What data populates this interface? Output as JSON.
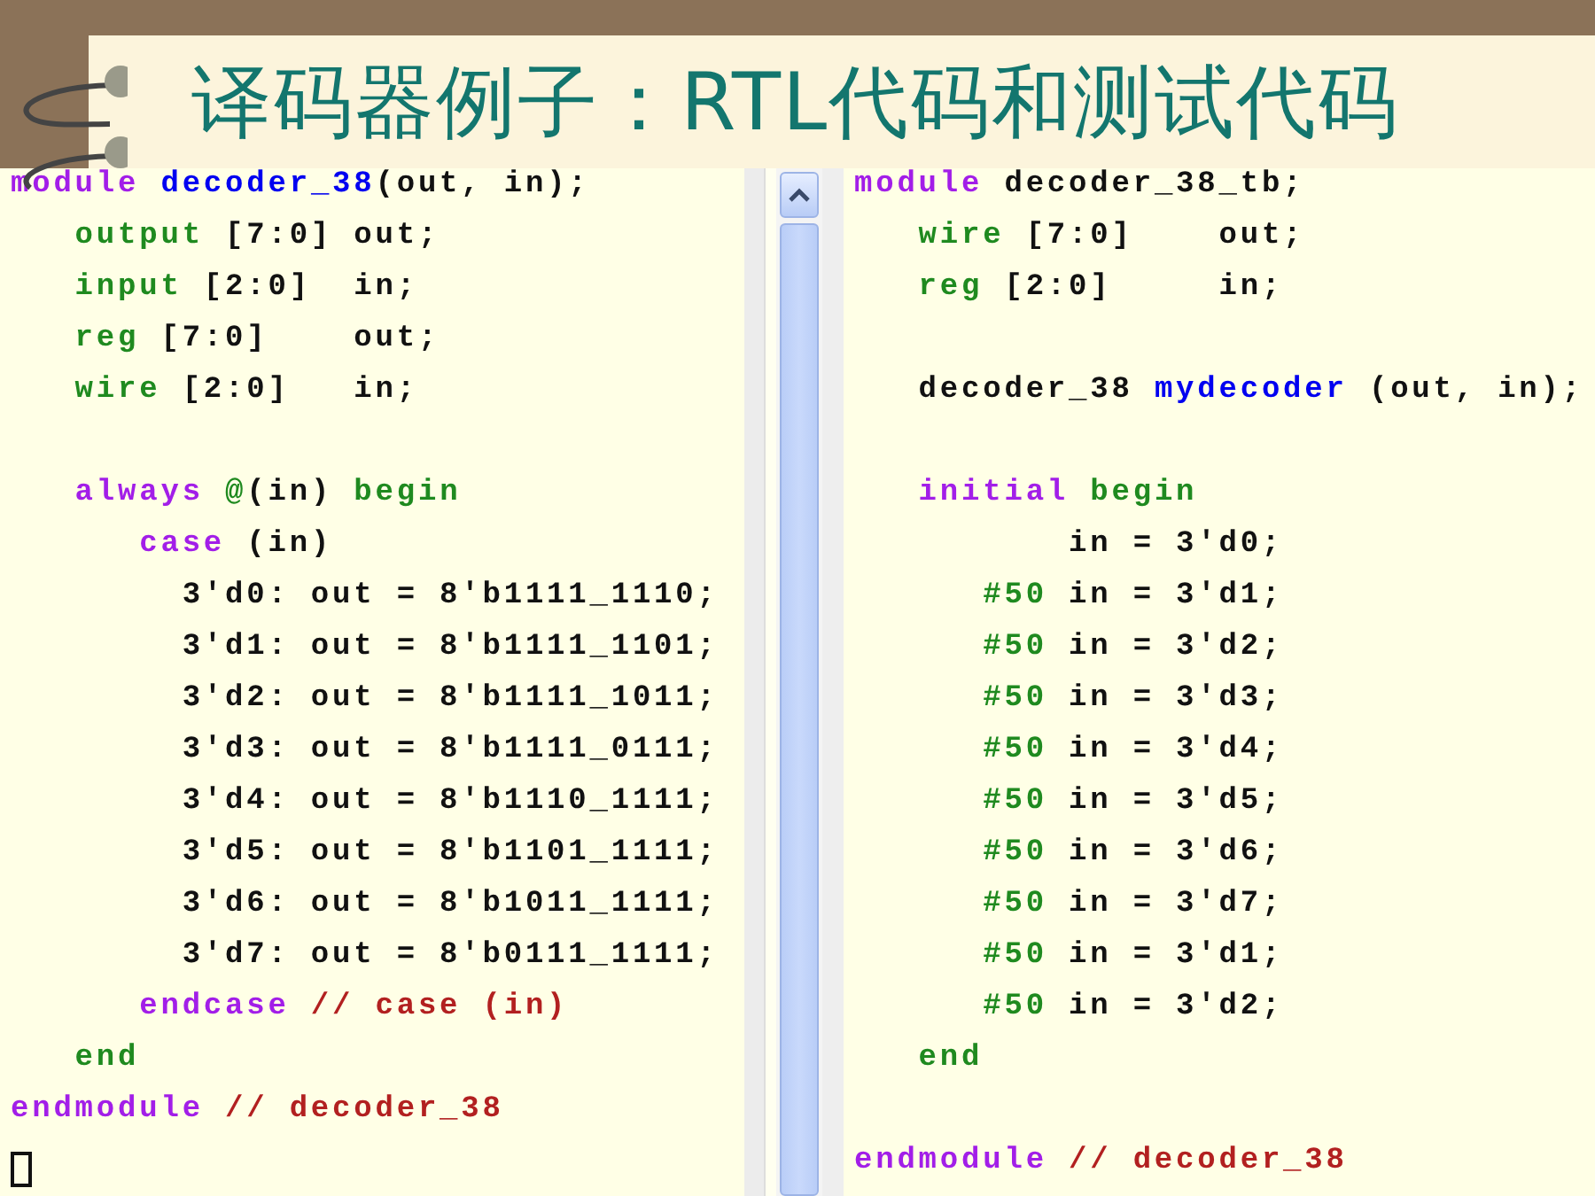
{
  "title": "译码器例子：RTL代码和测试代码",
  "panes": [
    {
      "lines": [
        {
          "kind": "code",
          "tokens": [
            {
              "text": "module",
              "kind": "keyword"
            },
            {
              "text": " decoder_38",
              "kind": "name"
            },
            {
              "text": "(out, in);",
              "kind": "plain"
            }
          ]
        },
        {
          "kind": "code",
          "tokens": [
            {
              "text": "   output",
              "kind": "type"
            },
            {
              "text": " [7:0] out;",
              "kind": "plain"
            }
          ]
        },
        {
          "kind": "code",
          "tokens": [
            {
              "text": "   input",
              "kind": "type"
            },
            {
              "text": " [2:0]  in;",
              "kind": "plain"
            }
          ]
        },
        {
          "kind": "code",
          "tokens": [
            {
              "text": "   reg",
              "kind": "type"
            },
            {
              "text": " [7:0]    out;",
              "kind": "plain"
            }
          ]
        },
        {
          "kind": "code",
          "tokens": [
            {
              "text": "   wire",
              "kind": "type"
            },
            {
              "text": " [2:0]   in;",
              "kind": "plain"
            }
          ]
        },
        {
          "kind": "blank"
        },
        {
          "kind": "code",
          "tokens": [
            {
              "text": "   always",
              "kind": "keyword"
            },
            {
              "text": " @",
              "kind": "type"
            },
            {
              "text": "(in) ",
              "kind": "plain"
            },
            {
              "text": "begin",
              "kind": "type"
            }
          ]
        },
        {
          "kind": "code",
          "tokens": [
            {
              "text": "      case",
              "kind": "keyword"
            },
            {
              "text": " (in)",
              "kind": "plain"
            }
          ]
        },
        {
          "kind": "code",
          "tokens": [
            {
              "text": "        3'd0: out = 8'b1111_1110;",
              "kind": "plain"
            }
          ]
        },
        {
          "kind": "code",
          "tokens": [
            {
              "text": "        3'd1: out = 8'b1111_1101;",
              "kind": "plain"
            }
          ]
        },
        {
          "kind": "code",
          "tokens": [
            {
              "text": "        3'd2: out = 8'b1111_1011;",
              "kind": "plain"
            }
          ]
        },
        {
          "kind": "code",
          "tokens": [
            {
              "text": "        3'd3: out = 8'b1111_0111;",
              "kind": "plain"
            }
          ]
        },
        {
          "kind": "code",
          "tokens": [
            {
              "text": "        3'd4: out = 8'b1110_1111;",
              "kind": "plain"
            }
          ]
        },
        {
          "kind": "code",
          "tokens": [
            {
              "text": "        3'd5: out = 8'b1101_1111;",
              "kind": "plain"
            }
          ]
        },
        {
          "kind": "code",
          "tokens": [
            {
              "text": "        3'd6: out = 8'b1011_1111;",
              "kind": "plain"
            }
          ]
        },
        {
          "kind": "code",
          "tokens": [
            {
              "text": "        3'd7: out = 8'b0111_1111;",
              "kind": "plain"
            }
          ]
        },
        {
          "kind": "code",
          "tokens": [
            {
              "text": "      endcase",
              "kind": "keyword"
            },
            {
              "text": " // case (in)",
              "kind": "comment"
            }
          ]
        },
        {
          "kind": "code",
          "tokens": [
            {
              "text": "   end",
              "kind": "type"
            }
          ]
        },
        {
          "kind": "code",
          "tokens": [
            {
              "text": "endmodule",
              "kind": "keyword"
            },
            {
              "text": " // decoder_38",
              "kind": "comment"
            }
          ]
        },
        {
          "kind": "cursor"
        }
      ]
    },
    {
      "lines": [
        {
          "kind": "code",
          "tokens": [
            {
              "text": "module",
              "kind": "keyword"
            },
            {
              "text": " decoder_38_tb;",
              "kind": "plain"
            }
          ]
        },
        {
          "kind": "code",
          "tokens": [
            {
              "text": "   wire",
              "kind": "type"
            },
            {
              "text": " [7:0]    out;",
              "kind": "plain"
            }
          ]
        },
        {
          "kind": "code",
          "tokens": [
            {
              "text": "   reg",
              "kind": "type"
            },
            {
              "text": " [2:0]     in;",
              "kind": "plain"
            }
          ]
        },
        {
          "kind": "blank"
        },
        {
          "kind": "code",
          "tokens": [
            {
              "text": "   decoder_38 ",
              "kind": "plain"
            },
            {
              "text": "mydecoder",
              "kind": "name"
            },
            {
              "text": " (out, in);",
              "kind": "plain"
            }
          ]
        },
        {
          "kind": "blank"
        },
        {
          "kind": "code",
          "tokens": [
            {
              "text": "   initial",
              "kind": "keyword"
            },
            {
              "text": " begin",
              "kind": "type"
            }
          ]
        },
        {
          "kind": "code",
          "tokens": [
            {
              "text": "          in = 3'd0;",
              "kind": "plain"
            }
          ]
        },
        {
          "kind": "code",
          "tokens": [
            {
              "text": "      #50",
              "kind": "type"
            },
            {
              "text": " in = 3'd1;",
              "kind": "plain"
            }
          ]
        },
        {
          "kind": "code",
          "tokens": [
            {
              "text": "      #50",
              "kind": "type"
            },
            {
              "text": " in = 3'd2;",
              "kind": "plain"
            }
          ]
        },
        {
          "kind": "code",
          "tokens": [
            {
              "text": "      #50",
              "kind": "type"
            },
            {
              "text": " in = 3'd3;",
              "kind": "plain"
            }
          ]
        },
        {
          "kind": "code",
          "tokens": [
            {
              "text": "      #50",
              "kind": "type"
            },
            {
              "text": " in = 3'd4;",
              "kind": "plain"
            }
          ]
        },
        {
          "kind": "code",
          "tokens": [
            {
              "text": "      #50",
              "kind": "type"
            },
            {
              "text": " in = 3'd5;",
              "kind": "plain"
            }
          ]
        },
        {
          "kind": "code",
          "tokens": [
            {
              "text": "      #50",
              "kind": "type"
            },
            {
              "text": " in = 3'd6;",
              "kind": "plain"
            }
          ]
        },
        {
          "kind": "code",
          "tokens": [
            {
              "text": "      #50",
              "kind": "type"
            },
            {
              "text": " in = 3'd7;",
              "kind": "plain"
            }
          ]
        },
        {
          "kind": "code",
          "tokens": [
            {
              "text": "      #50",
              "kind": "type"
            },
            {
              "text": " in = 3'd1;",
              "kind": "plain"
            }
          ]
        },
        {
          "kind": "code",
          "tokens": [
            {
              "text": "      #50",
              "kind": "type"
            },
            {
              "text": " in = 3'd2;",
              "kind": "plain"
            }
          ]
        },
        {
          "kind": "code",
          "tokens": [
            {
              "text": "   end",
              "kind": "type"
            }
          ]
        },
        {
          "kind": "blank"
        },
        {
          "kind": "code",
          "tokens": [
            {
              "text": "endmodule",
              "kind": "keyword"
            },
            {
              "text": " // decoder_38",
              "kind": "comment"
            }
          ]
        }
      ]
    }
  ]
}
